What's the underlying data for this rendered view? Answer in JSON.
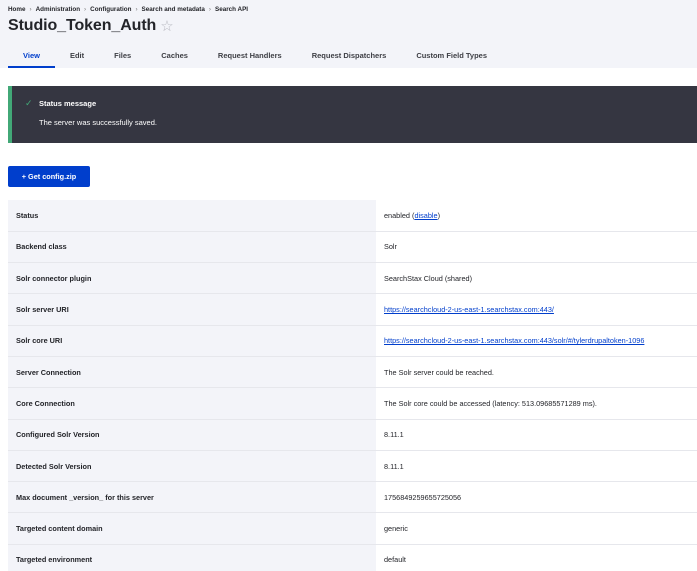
{
  "breadcrumb": [
    "Home",
    "Administration",
    "Configuration",
    "Search and metadata",
    "Search API"
  ],
  "page_title": "Studio_Token_Auth",
  "star_icon": "☆",
  "tabs": [
    {
      "label": "View",
      "active": true
    },
    {
      "label": "Edit",
      "active": false
    },
    {
      "label": "Files",
      "active": false
    },
    {
      "label": "Caches",
      "active": false
    },
    {
      "label": "Request Handlers",
      "active": false
    },
    {
      "label": "Request Dispatchers",
      "active": false
    },
    {
      "label": "Custom Field Types",
      "active": false
    }
  ],
  "status": {
    "icon": "✓",
    "title": "Status message",
    "message": "The server was successfully saved."
  },
  "get_config_button": "+ Get config.zip",
  "rows": {
    "status": {
      "key": "Status",
      "value_prefix": "enabled (",
      "link": "disable",
      "value_suffix": ")"
    },
    "backend_class": {
      "key": "Backend class",
      "value": "Solr"
    },
    "connector": {
      "key": "Solr connector plugin",
      "value": "SearchStax Cloud (shared)"
    },
    "server_uri": {
      "key": "Solr server URI",
      "value": "https://searchcloud-2-us-east-1.searchstax.com:443/"
    },
    "core_uri": {
      "key": "Solr core URI",
      "value": "https://searchcloud-2-us-east-1.searchstax.com:443/solr/#/tylerdrupaltoken-1096"
    },
    "server_connection": {
      "key": "Server Connection",
      "value": "The Solr server could be reached."
    },
    "core_connection": {
      "key": "Core Connection",
      "value": "The Solr core could be accessed (latency: 513.09685571289 ms)."
    },
    "configured_version": {
      "key": "Configured Solr Version",
      "value": "8.11.1"
    },
    "detected_version": {
      "key": "Detected Solr Version",
      "value": "8.11.1"
    },
    "max_version": {
      "key": "Max document _version_ for this server",
      "value": "1756849259655725056"
    },
    "content_domain": {
      "key": "Targeted content domain",
      "value": "generic"
    },
    "environment": {
      "key": "Targeted environment",
      "value": "default"
    }
  },
  "colors": {
    "accent": "#003ecc",
    "status_bg": "#353641",
    "status_border": "#42a877",
    "header_bg": "#f3f4f9"
  }
}
